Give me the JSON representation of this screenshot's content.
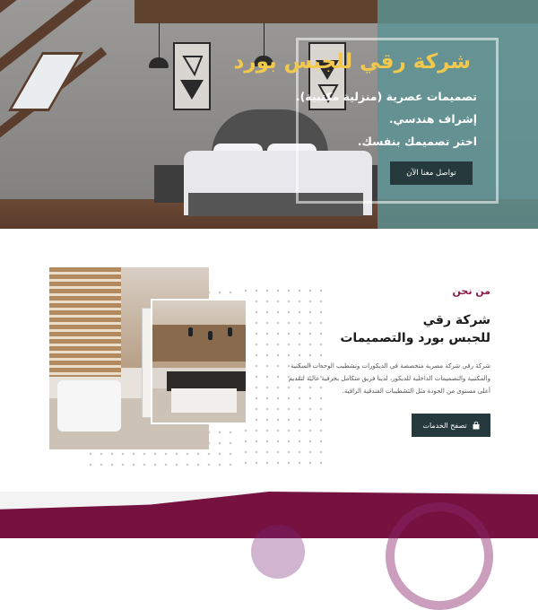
{
  "hero": {
    "title": "شركة رقي للجبس بورد",
    "lines": [
      "تصميمات عصرية (منزلية مكتبية).",
      "إشراف هندسي.",
      "اختر تصميمك بنفسك."
    ],
    "cta_label": "تواصل معنا الآن",
    "accent_color": "#f2c94c",
    "overlay_color": "#5c9294"
  },
  "about": {
    "eyebrow": "من نحن",
    "title_line1": "شركة رقي",
    "title_line2": "للجبس بورد والتصميمات",
    "body": "شركة رقي شركة مصرية متخصصة في الديكورات وتشطيب الوحدات السكنية والمكتبية والتصميمات الداخلية للديكور، لدينا فريق متكامل بحرفية عالية لتقديم أعلى مستوى من الجودة مثل التشطيبات الفندقية الراقية.",
    "button_label": "تصفح الخدمات",
    "button_icon": "shopping-bag-icon",
    "eyebrow_color": "#8b1a4a",
    "button_color": "#26393d"
  },
  "footer_band": {
    "color": "#76123f"
  }
}
